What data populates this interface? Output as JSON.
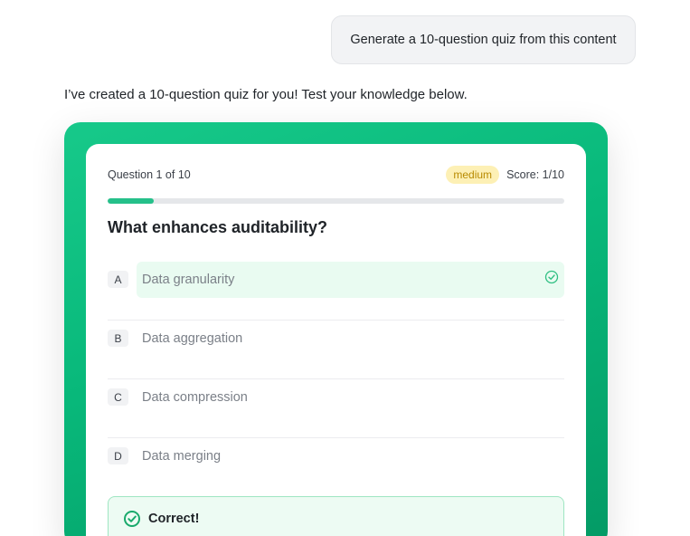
{
  "user_message": "Generate a 10-question quiz from this content",
  "assistant_message": "I’ve created a 10-question quiz for you! Test your knowledge below.",
  "quiz": {
    "question_counter": "Question 1 of 10",
    "difficulty": "medium",
    "score": "Score: 1/10",
    "progress": 0.1,
    "question": "What enhances auditability?",
    "options": [
      {
        "letter": "A",
        "text": "Data granularity",
        "state": "correct"
      },
      {
        "letter": "B",
        "text": "Data aggregation",
        "state": "none"
      },
      {
        "letter": "C",
        "text": "Data compression",
        "state": "none"
      },
      {
        "letter": "D",
        "text": "Data merging",
        "state": "none"
      }
    ],
    "feedback": "Correct!"
  },
  "colors": {
    "accent": "#08b87a",
    "progress": "#25c08a",
    "correct_bg": "#e9fbf1",
    "difficulty_bg": "#fdf0b5"
  },
  "icons": {
    "option_check": "check-circle-icon",
    "feedback": "check-circle-icon"
  }
}
